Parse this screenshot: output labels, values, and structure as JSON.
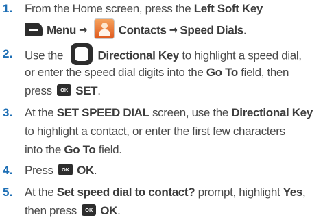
{
  "steps": [
    {
      "number": "1.",
      "line1": {
        "t1": "From the Home screen, press the ",
        "b1": "Left Soft Key"
      },
      "line2": {
        "b1": "Menu",
        "arrow1": "→",
        "b2": "Contacts",
        "arrow2": "→",
        "b3": "Speed Dials",
        "t1": "."
      }
    },
    {
      "number": "2.",
      "line1": {
        "t1": "Use the ",
        "b1": "Directional Key",
        "t2": " to highlight a speed dial,"
      },
      "line2": {
        "t1": "or enter the speed dial digits into the ",
        "b1": "Go To",
        "t2": " field, then"
      },
      "line3": {
        "t1": "press ",
        "ok": "OK",
        "b1": "SET",
        "t2": "."
      }
    },
    {
      "number": "3.",
      "line1": {
        "t1": "At the ",
        "b1": "SET SPEED DIAL",
        "t2": " screen, use the ",
        "b2": "Directional Key"
      },
      "line2": {
        "t1": "to highlight a contact, or enter the first few characters"
      },
      "line3": {
        "t1": "into the ",
        "b1": "Go To",
        "t2": " field."
      }
    },
    {
      "number": "4.",
      "line1": {
        "t1": "Press ",
        "ok": "OK",
        "b1": "OK",
        "t2": "."
      }
    },
    {
      "number": "5.",
      "line1": {
        "t1": "At the ",
        "b1": "Set speed dial to contact?",
        "t2": " prompt, highlight ",
        "b2": "Yes",
        "t3": ","
      },
      "line2": {
        "t1": "then press ",
        "ok": "OK",
        "b1": "OK",
        "t2": "."
      }
    }
  ],
  "colors": {
    "step_number": "#1e6fb5",
    "body_text": "#4a4a4a",
    "bold_text": "#3c3c3c",
    "key_icon": "#2d2d2d"
  },
  "icons": [
    "left-soft-key-icon",
    "contacts-app-icon",
    "directional-key-icon",
    "ok-key-icon"
  ]
}
